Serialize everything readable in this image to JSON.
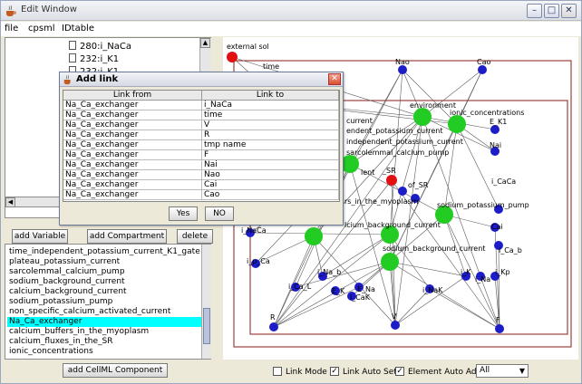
{
  "window": {
    "title": "Edit Window",
    "icon": "java-coffee-icon"
  },
  "menu": [
    "file",
    "cpsml",
    "IDtable"
  ],
  "tree": {
    "items": [
      "280:i_NaCa",
      "232:i_K1",
      "232:i_K1"
    ]
  },
  "buttons": {
    "add_variable": "add Variable",
    "add_compartment": "add Compartment",
    "delete": "delete",
    "add_component": "add CellML Component"
  },
  "components": [
    "time_independent_potassium_current_K1_gate",
    "plateau_potassium_current",
    "sarcolemmal_calcium_pump",
    "sodium_background_current",
    "calcium_background_current",
    "sodium_potassium_pump",
    "non_specific_calcium_activated_current",
    "Na_Ca_exchanger",
    "calcium_buffers_in_the_myoplasm",
    "calcium_fluxes_in_the_SR",
    "ionic_concentrations"
  ],
  "selected_component": "Na_Ca_exchanger",
  "dialog": {
    "title": "Add link",
    "headers": [
      "Link from",
      "Link to"
    ],
    "rows": [
      [
        "Na_Ca_exchanger",
        "i_NaCa"
      ],
      [
        "Na_Ca_exchanger",
        "time"
      ],
      [
        "Na_Ca_exchanger",
        "V"
      ],
      [
        "Na_Ca_exchanger",
        "R"
      ],
      [
        "Na_Ca_exchanger",
        "tmp name"
      ],
      [
        "Na_Ca_exchanger",
        "F"
      ],
      [
        "Na_Ca_exchanger",
        "Nai"
      ],
      [
        "Na_Ca_exchanger",
        "Nao"
      ],
      [
        "Na_Ca_exchanger",
        "Cai"
      ],
      [
        "Na_Ca_exchanger",
        "Cao"
      ]
    ],
    "yes": "Yes",
    "no": "NO"
  },
  "graph": {
    "labels": {
      "external_sol": "external sol",
      "time": "time",
      "nao": "Nao",
      "cao": "Cao",
      "environment": "environment",
      "ionic": "ionic_concentrations",
      "ek1": "E_K1",
      "current": "current",
      "dependent": "endent_potassium_current",
      "indep": "independent_potassium_current",
      "sarco": "sarcolemmal_calcium_pump",
      "nai": "Nai",
      "sr": "_SR",
      "lent": "lent",
      "icaca": "i_CaCa",
      "ofr": "of_SR",
      "myoplasm": "rs_in_the_myoplasm",
      "nakpump": "sodium_potassium_pump",
      "cabg": "lcium_background_current",
      "cai": "Cai",
      "nabg": "sodium_background_current",
      "inaca": "i_NaCa",
      "icab": "i_Ca_b",
      "ipca": "i_p_Ca",
      "inab": "i_Na_b",
      "ik": "i_K",
      "ina": "i_Na",
      "ikp": "i_Kp",
      "ical": "i_Ca_L",
      "icak": "i_CaK",
      "ek": "E_K",
      "ena": "E_Na",
      "inak": "i_NaK",
      "r": "R",
      "v": "V",
      "f": "F"
    }
  },
  "bottom": {
    "link_mode": "Link Mode",
    "link_auto_set": "Link Auto Set",
    "element_auto_add": "Element Auto Add",
    "filter": "All",
    "link_mode_checked": false,
    "link_auto_set_checked": true,
    "element_auto_add_checked": true
  },
  "colors": {
    "selection": "#00ffff",
    "node_blue": "#1c1cc8",
    "node_green": "#22cc22",
    "node_red": "#e01010",
    "compartment_border": "#8b1a1a"
  }
}
